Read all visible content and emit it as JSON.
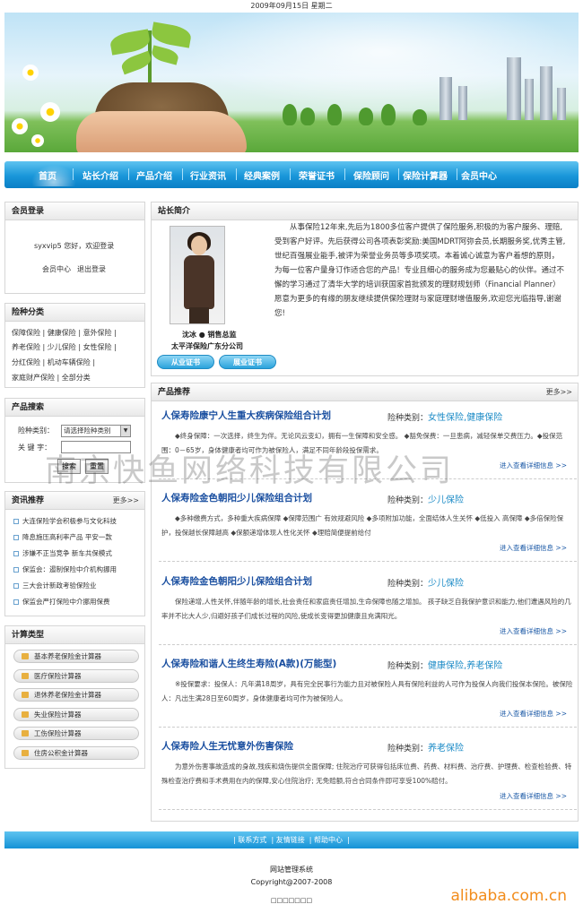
{
  "date_bar": "2009年09月15日  星期二",
  "nav": {
    "items": [
      "首页",
      "站长介绍",
      "产品介绍",
      "行业资讯",
      "经典案例",
      "荣誉证书",
      "保险顾问",
      "保险计算器",
      "会员中心"
    ]
  },
  "login": {
    "title": "会员登录",
    "welcome": "syxvip5 您好，欢迎登录",
    "member_center": "会员中心",
    "logout": "退出登录"
  },
  "categories": {
    "title": "险种分类",
    "lines": [
      [
        "保障保险",
        "健康保险",
        "意外保险"
      ],
      [
        "养老保险",
        "少儿保险",
        "女性保险"
      ],
      [
        "分红保险",
        "机动车辆保险"
      ],
      [
        "家庭财产保险",
        "全部分类"
      ]
    ]
  },
  "search": {
    "title": "产品搜索",
    "type_label": "险种类别：",
    "type_value": "请选择险种类别",
    "keyword_label": "关 键 字：",
    "search_btn": "搜索",
    "reset_btn": "重置"
  },
  "news": {
    "title": "资讯推荐",
    "more": "更多>>",
    "items": [
      "大连保险学会积极参与文化科技",
      "降息施压高利率产品  平安一款",
      "涉嫌不正当竞争  新车共保模式",
      "保监会：遏制保险中介机构挪用",
      "三大会计新政考验保险业",
      "保监会严打保险中介挪用保费"
    ]
  },
  "calculators": {
    "title": "计算类型",
    "items": [
      "基本养老保险金计算器",
      "医疗保险计算器",
      "退休养老保险金计算器",
      "失业保险计算器",
      "工伤保险计算器",
      "住房公积金计算器"
    ]
  },
  "intro": {
    "title": "站长简介",
    "caption_name": "沈冰  ● 销售总监",
    "caption_company": "太平洋保险广东分公司",
    "text": "从事保险12年来,先后为1800多位客户提供了保险服务,积极的为客户服务、理赔,受到客户好评。先后获得公司各项表彰奖励:美国MDRT阿弥会员,长期服务奖,优秀主管,世纪百强展业能手,被评为荣誉业务员等多项奖项。本着诚心诚意为客户着想的原则，为每一位客户量身订作适合您的产品！专业且细心的服务成为您最贴心的伙伴。通过不懈的学习通过了清华大学的培训获国家首批颁发的理财规划师（Financial Planner）愿意为更多的有缘的朋友继续提供保险理财与家庭理财增值服务,欢迎您光临指导,谢谢您!",
    "cert_btn1": "从业证书",
    "cert_btn2": "展业证书"
  },
  "products": {
    "title": "产品推荐",
    "more": "更多>>",
    "cat_label": "险种类别：",
    "link_text": "进入查看详细信息 >>",
    "items": [
      {
        "title": "人保寿险康宁人生重大疾病保险组合计划",
        "category": "女性保险,健康保险",
        "desc": "◆终身保障：一次选择，终生为伴。无论风云变幻，拥有一生保障和安全感。 ◆豁免保费：一旦患病，减轻保单交费压力。◆投保范围：0－65岁，身体健康者均可作为被保险人，满足不同年龄段投保需求。"
      },
      {
        "title": "人保寿险金色朝阳少儿保险组合计划",
        "category": "少儿保险",
        "desc": "◆多种缴费方式，多种重大疾病保障 ◆保障范围广 有效规避风险 ◆多项附加功能，全面结体人生关怀 ◆低投入 高保障 ◆多倍保险保护，投保越长保障越高 ◆保额递增体现人性化关怀 ◆理赔简便提前给付"
      },
      {
        "title": "人保寿险金色朝阳少儿保险组合计划",
        "category": "少儿保险",
        "desc": "保险递增,人性关怀,伴随年龄的增长,社会责任和家庭责任增加,生命保障也随之增加。 孩子缺乏自我保护意识和能力,他们遭遇风险的几率并不比大人少,归避好孩子们成长过程的风险,使成长变得更加健康且充满阳光。"
      },
      {
        "title": "人保寿险和谐人生终生寿险(A款)(万能型)",
        "category": "健康保险,养老保险",
        "desc": "※投保要求：投保人：凡年满18周岁，具有完全民事行为能力且对被保险人具有保险利益的人可作为投保人向我们投保本保险。被保险人：凡出生满28日至60周岁，身体健康者均可作为被保险人。"
      },
      {
        "title": "人保寿险人生无忧意外伤害保险",
        "category": "养老保险",
        "desc": "为意外伤害事故造成的身故,残疾和烧伤提供全面保障; 住院治疗可获得包括床位费、药费、材料费、治疗费、护理费、检查检验费、特殊检查治疗费和手术费用在内的保障,安心住院治疗; 无免赔额,符合合同条件即可享受100%赔付。"
      }
    ]
  },
  "watermark": "南京快鱼网络科技有限公司",
  "footer": {
    "links": [
      "联系方式",
      "友情链接",
      "帮助中心"
    ],
    "line1": "网站管理系统",
    "line2": "Copyright@2007-2008",
    "line3": "□□□□□□□"
  },
  "alibaba": "alibaba.com.cn"
}
